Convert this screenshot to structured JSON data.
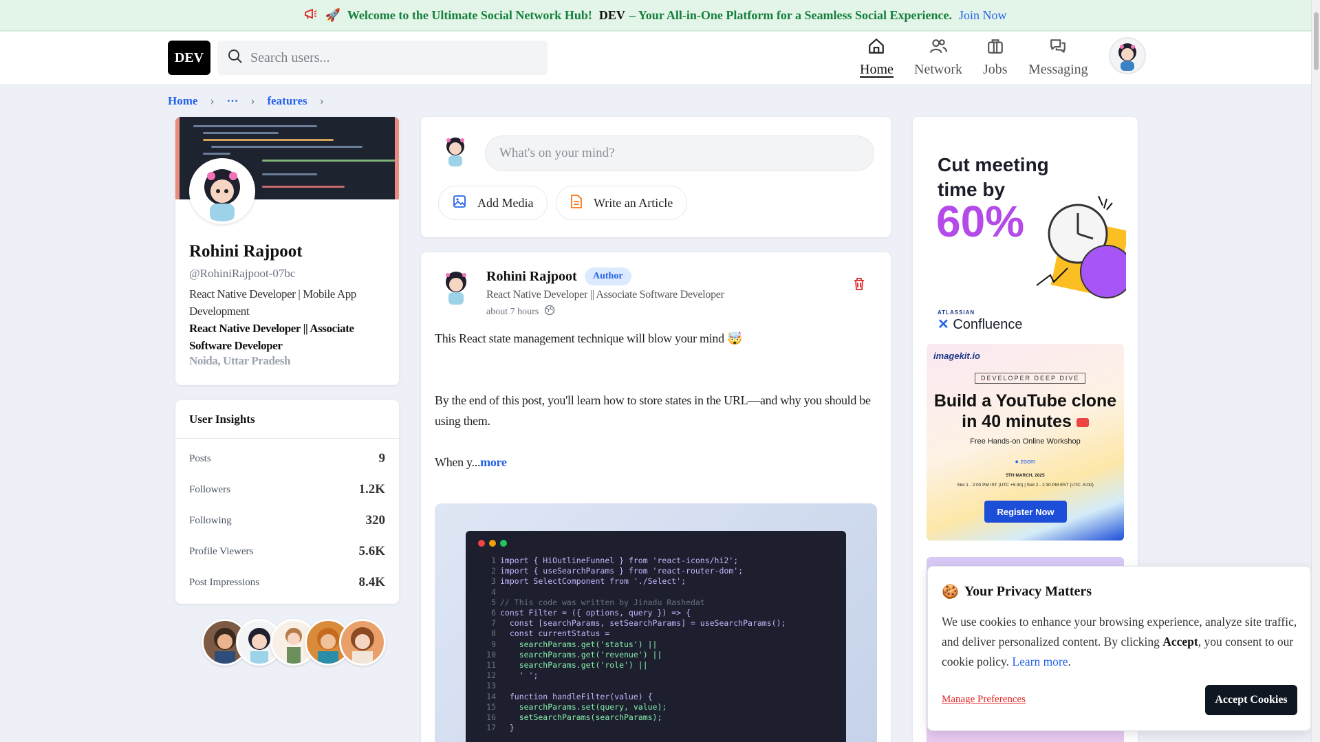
{
  "announcement": {
    "welcome": "Welcome to the Ultimate Social Network Hub!",
    "brand": "DEV",
    "tagline": "– Your All-in-One Platform for a Seamless Social Experience.",
    "join": "Join Now"
  },
  "header": {
    "logo": "DEV",
    "search_placeholder": "Search users...",
    "nav": [
      {
        "label": "Home",
        "icon": "home-icon",
        "active": true
      },
      {
        "label": "Network",
        "icon": "users-icon"
      },
      {
        "label": "Jobs",
        "icon": "briefcase-icon"
      },
      {
        "label": "Messaging",
        "icon": "chat-icon"
      }
    ]
  },
  "breadcrumb": [
    "Home",
    "···",
    "features"
  ],
  "profile": {
    "name": "Rohini Rajpoot",
    "handle": "@RohiniRajpoot-07bc",
    "bio": "React Native Developer | Mobile App Development",
    "title": "React Native Developer || Associate Software Developer",
    "location": "Noida, Uttar Pradesh"
  },
  "insights": {
    "title": "User Insights",
    "rows": [
      {
        "label": "Posts",
        "value": "9"
      },
      {
        "label": "Followers",
        "value": "1.2K"
      },
      {
        "label": "Following",
        "value": "320"
      },
      {
        "label": "Profile Viewers",
        "value": "5.6K"
      },
      {
        "label": "Post Impressions",
        "value": "8.4K"
      }
    ]
  },
  "composer": {
    "placeholder": "What's on your mind?",
    "add_media": "Add Media",
    "write_article": "Write an Article"
  },
  "post": {
    "author": "Rohini Rajpoot",
    "badge": "Author",
    "title": "React Native Developer || Associate Software Developer",
    "time": "about 7 hours",
    "line1": "This React state management technique will blow your mind 🤯",
    "line2": "By the end of this post, you'll learn how to store states in the URL—and why you should be using them.",
    "line3": "When y...",
    "more": "more",
    "code": [
      "import { HiOutlineFunnel } from 'react-icons/hi2';",
      "import { useSearchParams } from 'react-router-dom';",
      "import SelectComponent from './Select';",
      "",
      "// This code was written by Jinadu Rashedat",
      "const Filter = ({ options, query }) => {",
      "  const [searchParams, setSearchParams] = useSearchParams();",
      "  const currentStatus =",
      "    searchParams.get('status') ||",
      "    searchParams.get('revenue') ||",
      "    searchParams.get('role') ||",
      "    ' ';",
      "",
      "  function handleFilter(value) {",
      "    searchParams.set(query, value);",
      "    setSearchParams(searchParams);",
      "  }"
    ]
  },
  "ads": {
    "confluence": {
      "headline": "Cut meeting time by",
      "percent": "60%",
      "atlassian": "ATLASSIAN",
      "product": "Confluence"
    },
    "imagekit": {
      "logo": "imagekit.io",
      "tag": "DEVELOPER DEEP DIVE",
      "title": "Build a YouTube clone in 40 minutes",
      "sub": "Free Hands-on Online Workshop",
      "zoom": "zoom",
      "date": "5TH MARCH, 2025",
      "slots": "Slot 1 - 2:00 PM IST (UTC +5:30)  |  Slot 2 - 2:30 PM EST (UTC -5:00)",
      "cta": "Register Now"
    }
  },
  "cookie": {
    "title": "Your Privacy Matters",
    "body_pre": "We use cookies to enhance your browsing experience, analyze site traffic, and deliver personalized content. By clicking ",
    "body_bold": "Accept",
    "body_post": ", you consent to our cookie policy. ",
    "learn_more": "Learn more",
    "manage": "Manage Preferences",
    "accept": "Accept Cookies"
  },
  "colors": {
    "accent": "#2563eb",
    "announce_bg": "#e3f5e8",
    "announce_text": "#15803d",
    "danger": "#dc2626"
  }
}
